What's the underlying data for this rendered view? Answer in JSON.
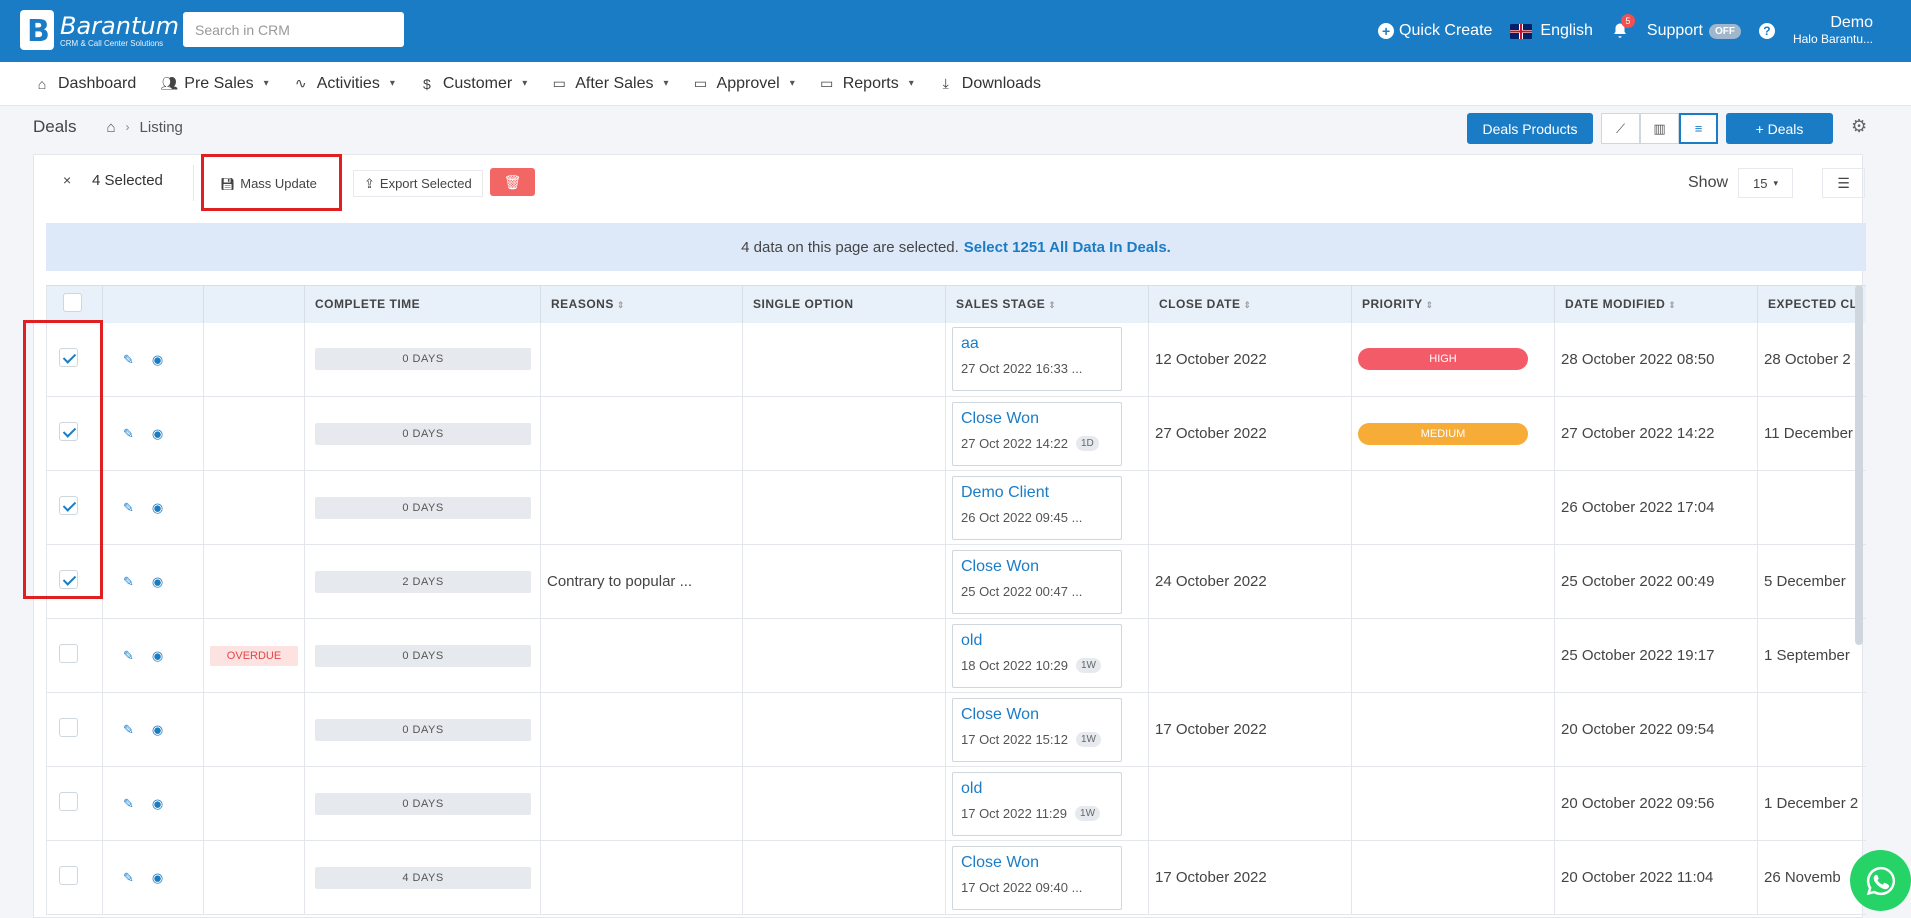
{
  "brand": {
    "name": "Barantum",
    "tagline": "CRM & Call Center Solutions"
  },
  "search": {
    "placeholder": "Search in CRM"
  },
  "topbar": {
    "quick_create": "Quick Create",
    "language": "English",
    "notification_count": "5",
    "support": "Support",
    "support_toggle": "OFF",
    "help": "?",
    "user_name": "Demo",
    "user_company": "Halo Barantu..."
  },
  "nav": [
    {
      "label": "Dashboard",
      "icon": "home-icon",
      "dropdown": false
    },
    {
      "label": "Pre Sales",
      "icon": "users-icon",
      "dropdown": true
    },
    {
      "label": "Activities",
      "icon": "activity-icon",
      "dropdown": true
    },
    {
      "label": "Customer",
      "icon": "dollar-icon",
      "dropdown": true
    },
    {
      "label": "After Sales",
      "icon": "folder-icon",
      "dropdown": true
    },
    {
      "label": "Approvel",
      "icon": "folder-icon",
      "dropdown": true
    },
    {
      "label": "Reports",
      "icon": "folder-icon",
      "dropdown": true
    },
    {
      "label": "Downloads",
      "icon": "download-icon",
      "dropdown": false
    }
  ],
  "breadcrumb": {
    "title": "Deals",
    "current": "Listing"
  },
  "actions": {
    "deals_products": "Deals Products",
    "deals": "+ Deals"
  },
  "toolbar": {
    "close": "×",
    "selected": "4 Selected",
    "mass_update": "Mass Update",
    "export_selected": "Export Selected",
    "show_label": "Show",
    "show_value": "15"
  },
  "banner": {
    "text": "4 data on this page are selected.",
    "link": "Select 1251 All Data In Deals."
  },
  "columns": [
    "",
    "",
    "",
    "COMPLETE TIME",
    "REASONS",
    "SINGLE OPTION",
    "SALES STAGE",
    "CLOSE DATE",
    "PRIORITY",
    "DATE MODIFIED",
    "EXPECTED CL"
  ],
  "rows": [
    {
      "checked": true,
      "overdue": "",
      "complete_time": "0 DAYS",
      "reasons": "",
      "single_option": "",
      "stage_name": "aa",
      "stage_date": "27 Oct 2022 16:33 ...",
      "stage_badge": "",
      "close_date": "12 October 2022",
      "priority": "HIGH",
      "priority_color": "#f45b69",
      "date_modified": "28 October 2022 08:50",
      "expected": "28 October 2"
    },
    {
      "checked": true,
      "overdue": "",
      "complete_time": "0 DAYS",
      "reasons": "",
      "single_option": "",
      "stage_name": "Close Won",
      "stage_date": "27 Oct 2022 14:22",
      "stage_badge": "1D",
      "close_date": "27 October 2022",
      "priority": "MEDIUM",
      "priority_color": "#f7ac38",
      "date_modified": "27 October 2022 14:22",
      "expected": "11 December"
    },
    {
      "checked": true,
      "overdue": "",
      "complete_time": "0 DAYS",
      "reasons": "",
      "single_option": "",
      "stage_name": "Demo Client",
      "stage_date": "26 Oct 2022 09:45 ...",
      "stage_badge": "",
      "close_date": "",
      "priority": "",
      "priority_color": "",
      "date_modified": "26 October 2022 17:04",
      "expected": ""
    },
    {
      "checked": true,
      "overdue": "",
      "complete_time": "2 DAYS",
      "reasons": "Contrary to popular ...",
      "single_option": "",
      "stage_name": "Close Won",
      "stage_date": "25 Oct 2022 00:47 ...",
      "stage_badge": "",
      "close_date": "24 October 2022",
      "priority": "",
      "priority_color": "",
      "date_modified": "25 October 2022 00:49",
      "expected": "5 December"
    },
    {
      "checked": false,
      "overdue": "OVERDUE",
      "complete_time": "0 DAYS",
      "reasons": "",
      "single_option": "",
      "stage_name": "old",
      "stage_date": "18 Oct 2022 10:29",
      "stage_badge": "1W",
      "close_date": "",
      "priority": "",
      "priority_color": "",
      "date_modified": "25 October 2022 19:17",
      "expected": "1 September"
    },
    {
      "checked": false,
      "overdue": "",
      "complete_time": "0 DAYS",
      "reasons": "",
      "single_option": "",
      "stage_name": "Close Won",
      "stage_date": "17 Oct 2022 15:12",
      "stage_badge": "1W",
      "close_date": "17 October 2022",
      "priority": "",
      "priority_color": "",
      "date_modified": "20 October 2022 09:54",
      "expected": ""
    },
    {
      "checked": false,
      "overdue": "",
      "complete_time": "0 DAYS",
      "reasons": "",
      "single_option": "",
      "stage_name": "old",
      "stage_date": "17 Oct 2022 11:29",
      "stage_badge": "1W",
      "close_date": "",
      "priority": "",
      "priority_color": "",
      "date_modified": "20 October 2022 09:56",
      "expected": "1 December 2"
    },
    {
      "checked": false,
      "overdue": "",
      "complete_time": "4 DAYS",
      "reasons": "",
      "single_option": "",
      "stage_name": "Close Won",
      "stage_date": "17 Oct 2022 09:40 ...",
      "stage_badge": "",
      "close_date": "17 October 2022",
      "priority": "",
      "priority_color": "",
      "date_modified": "20 October 2022 11:04",
      "expected": "26 Novemb"
    }
  ],
  "colors": {
    "primary": "#1b7cc6",
    "highlight": "#e02020",
    "whatsapp": "#25d366"
  }
}
